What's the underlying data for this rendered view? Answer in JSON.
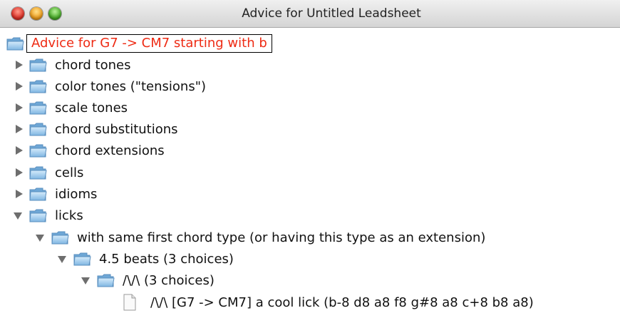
{
  "window": {
    "title": "Advice for Untitled Leadsheet"
  },
  "tree": {
    "root_label": "Advice for G7 -> CM7 starting with b",
    "items": [
      {
        "label": "chord tones"
      },
      {
        "label": "color tones (\"tensions\")"
      },
      {
        "label": "scale tones"
      },
      {
        "label": "chord substitutions"
      },
      {
        "label": "chord extensions"
      },
      {
        "label": "cells"
      },
      {
        "label": "idioms"
      },
      {
        "label": "licks"
      }
    ],
    "licks_child": "with same first chord type (or having this type as an extension)",
    "beats_node": "4.5 beats  (3 choices)",
    "contour_node": "/\\/\\ (3 choices)",
    "leaf": "/\\/\\  [G7 -> CM7]  a cool lick (b-8 d8 a8 f8 g#8 a8 c+8 b8 a8)"
  },
  "colors": {
    "root_text": "#ee2b14",
    "arrow": "#6e6e6e",
    "folder_blue": "#8fc3ea"
  },
  "icons": [
    "close-icon",
    "minimize-icon",
    "zoom-icon",
    "folder-icon",
    "document-icon",
    "expand-arrow-icon",
    "collapse-arrow-icon"
  ]
}
